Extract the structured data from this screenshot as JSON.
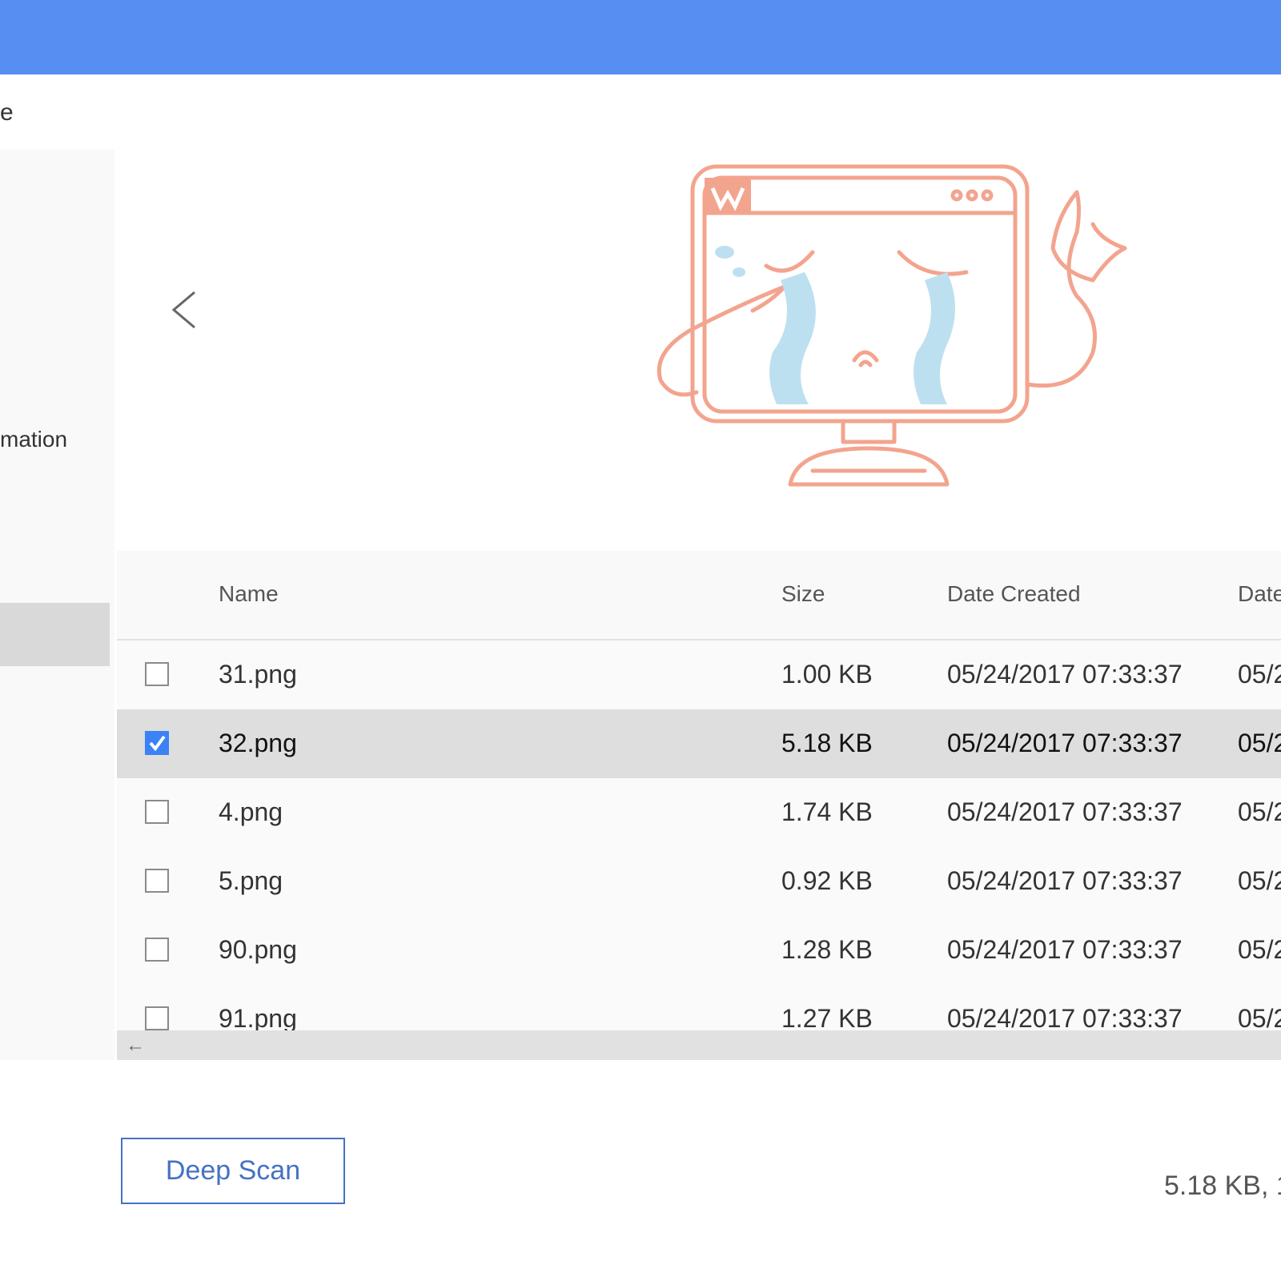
{
  "window": {
    "accent": "#568ef2"
  },
  "top_label": "e",
  "sidebar": {
    "items": [
      {
        "label": "mation"
      }
    ]
  },
  "preview": {
    "prev_icon": "chevron-left-icon",
    "illustration": "crying-monitor-illustration"
  },
  "table": {
    "columns": [
      "Name",
      "Size",
      "Date Created",
      "Date"
    ],
    "rows": [
      {
        "checked": false,
        "name": "31.png",
        "size": "1.00 KB",
        "created": "05/24/2017 07:33:37",
        "modified": "05/2"
      },
      {
        "checked": true,
        "name": "32.png",
        "size": "5.18 KB",
        "created": "05/24/2017 07:33:37",
        "modified": "05/2"
      },
      {
        "checked": false,
        "name": "4.png",
        "size": "1.74 KB",
        "created": "05/24/2017 07:33:37",
        "modified": "05/2"
      },
      {
        "checked": false,
        "name": "5.png",
        "size": "0.92 KB",
        "created": "05/24/2017 07:33:37",
        "modified": "05/2"
      },
      {
        "checked": false,
        "name": "90.png",
        "size": "1.28 KB",
        "created": "05/24/2017 07:33:37",
        "modified": "05/2"
      },
      {
        "checked": false,
        "name": "91.png",
        "size": "1.27 KB",
        "created": "05/24/2017 07:33:37",
        "modified": "05/2"
      }
    ]
  },
  "scrollbar": {
    "left_arrow": "←"
  },
  "footer": {
    "deep_scan_label": "Deep Scan",
    "summary": "5.18 KB, 1"
  }
}
